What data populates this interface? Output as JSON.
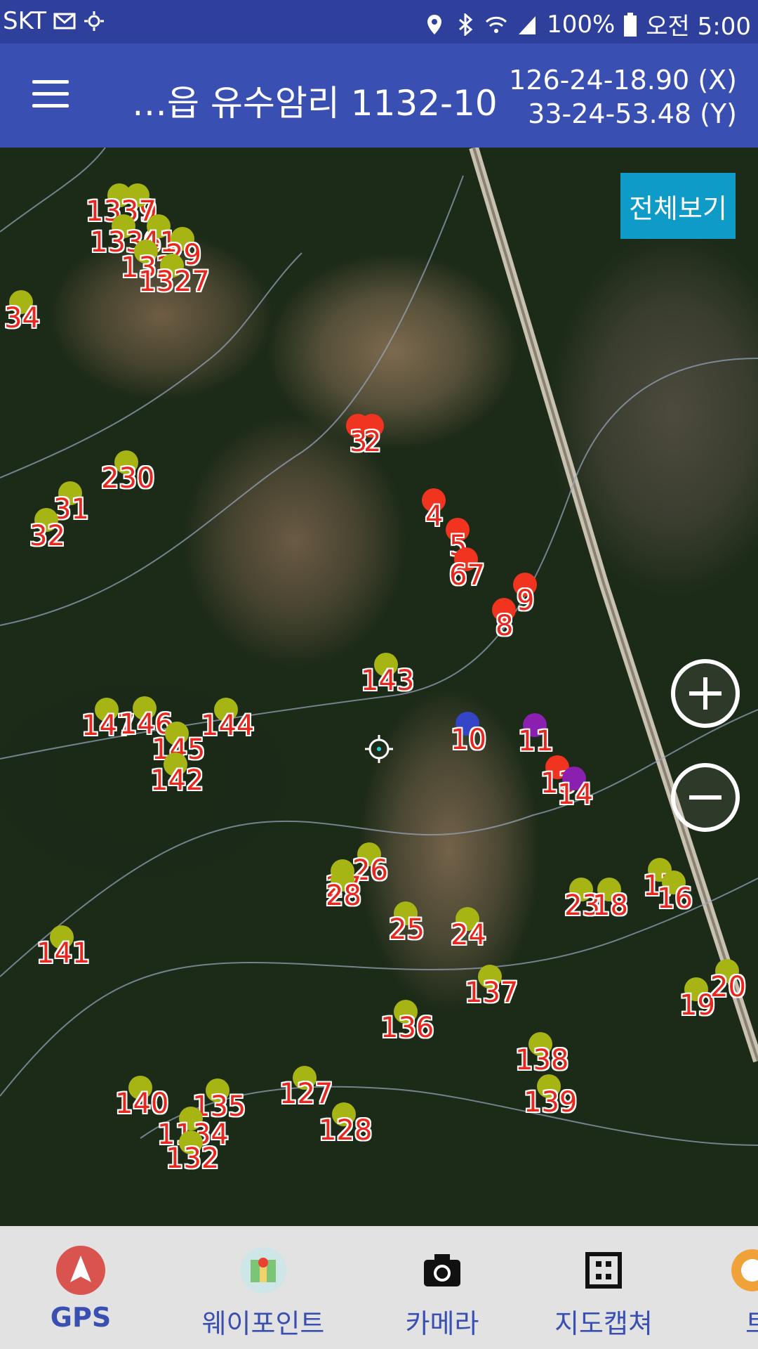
{
  "status_bar": {
    "carrier": "SKT",
    "battery": "100%",
    "time": "오전 5:00",
    "icons": [
      "mail-icon",
      "weather-icon",
      "location-icon",
      "bluetooth-icon",
      "wifi-icon",
      "signal-icon",
      "battery-icon"
    ]
  },
  "app_bar": {
    "title": "…읍 유수암리 1132-10",
    "coord_x": "126-24-18.90 (X)",
    "coord_y": "33-24-53.48 (Y)"
  },
  "map": {
    "view_all_label": "전체보기",
    "markers": [
      {
        "label": "1339",
        "color": "#a6b414"
      },
      {
        "label": "37",
        "color": "#a6b414"
      },
      {
        "label": "1336",
        "color": "#a6b414"
      },
      {
        "label": "41",
        "color": "#a6b414"
      },
      {
        "label": "29",
        "color": "#a6b414"
      },
      {
        "label": "132",
        "color": "#a6b414"
      },
      {
        "label": "1327",
        "color": "#a6b414"
      },
      {
        "label": "34",
        "color": "#a6b414"
      },
      {
        "label": "230",
        "color": "#a6b414"
      },
      {
        "label": "31",
        "color": "#a6b414"
      },
      {
        "label": "32",
        "color": "#a6b414"
      },
      {
        "label": "3",
        "color": "#f0341f"
      },
      {
        "label": "2",
        "color": "#f0341f"
      },
      {
        "label": "4",
        "color": "#f0341f"
      },
      {
        "label": "5",
        "color": "#f0341f"
      },
      {
        "label": "67",
        "color": "#f0341f"
      },
      {
        "label": "9",
        "color": "#f0341f"
      },
      {
        "label": "8",
        "color": "#f0341f"
      },
      {
        "label": "143",
        "color": "#a6b414"
      },
      {
        "label": "147",
        "color": "#a6b414"
      },
      {
        "label": "146",
        "color": "#a6b414"
      },
      {
        "label": "144",
        "color": "#a6b414"
      },
      {
        "label": "145",
        "color": "#a6b414"
      },
      {
        "label": "142",
        "color": "#a6b414"
      },
      {
        "label": "10",
        "color": "#3545c8"
      },
      {
        "label": "11",
        "color": "#8a1fb0"
      },
      {
        "label": "13",
        "color": "#f0341f"
      },
      {
        "label": "14",
        "color": "#8a1fb0"
      },
      {
        "label": "26",
        "color": "#a6b414"
      },
      {
        "label": "27",
        "color": "#a6b414"
      },
      {
        "label": "28",
        "color": "#a6b414"
      },
      {
        "label": "17",
        "color": "#a6b414"
      },
      {
        "label": "16",
        "color": "#a6b414"
      },
      {
        "label": "23",
        "color": "#a6b414"
      },
      {
        "label": "18",
        "color": "#a6b414"
      },
      {
        "label": "25",
        "color": "#a6b414"
      },
      {
        "label": "24",
        "color": "#a6b414"
      },
      {
        "label": "141",
        "color": "#a6b414"
      },
      {
        "label": "137",
        "color": "#a6b414"
      },
      {
        "label": "19",
        "color": "#a6b414"
      },
      {
        "label": "20",
        "color": "#a6b414"
      },
      {
        "label": "136",
        "color": "#a6b414"
      },
      {
        "label": "138",
        "color": "#a6b414"
      },
      {
        "label": "139",
        "color": "#a6b414"
      },
      {
        "label": "140",
        "color": "#a6b414"
      },
      {
        "label": "135",
        "color": "#a6b414"
      },
      {
        "label": "127",
        "color": "#a6b414"
      },
      {
        "label": "128",
        "color": "#a6b414"
      },
      {
        "label": "1134",
        "color": "#a6b414"
      },
      {
        "label": "132",
        "color": "#a6b414"
      }
    ]
  },
  "bottom_nav": {
    "items": [
      {
        "label": "GPS",
        "icon": "gps-arrow-icon",
        "active": true
      },
      {
        "label": "웨이포인트",
        "icon": "map-pin-icon"
      },
      {
        "label": "카메라",
        "icon": "camera-icon"
      },
      {
        "label": "지도캡쳐",
        "icon": "grid-capture-icon"
      },
      {
        "label": "트",
        "icon": "track-icon"
      }
    ]
  }
}
